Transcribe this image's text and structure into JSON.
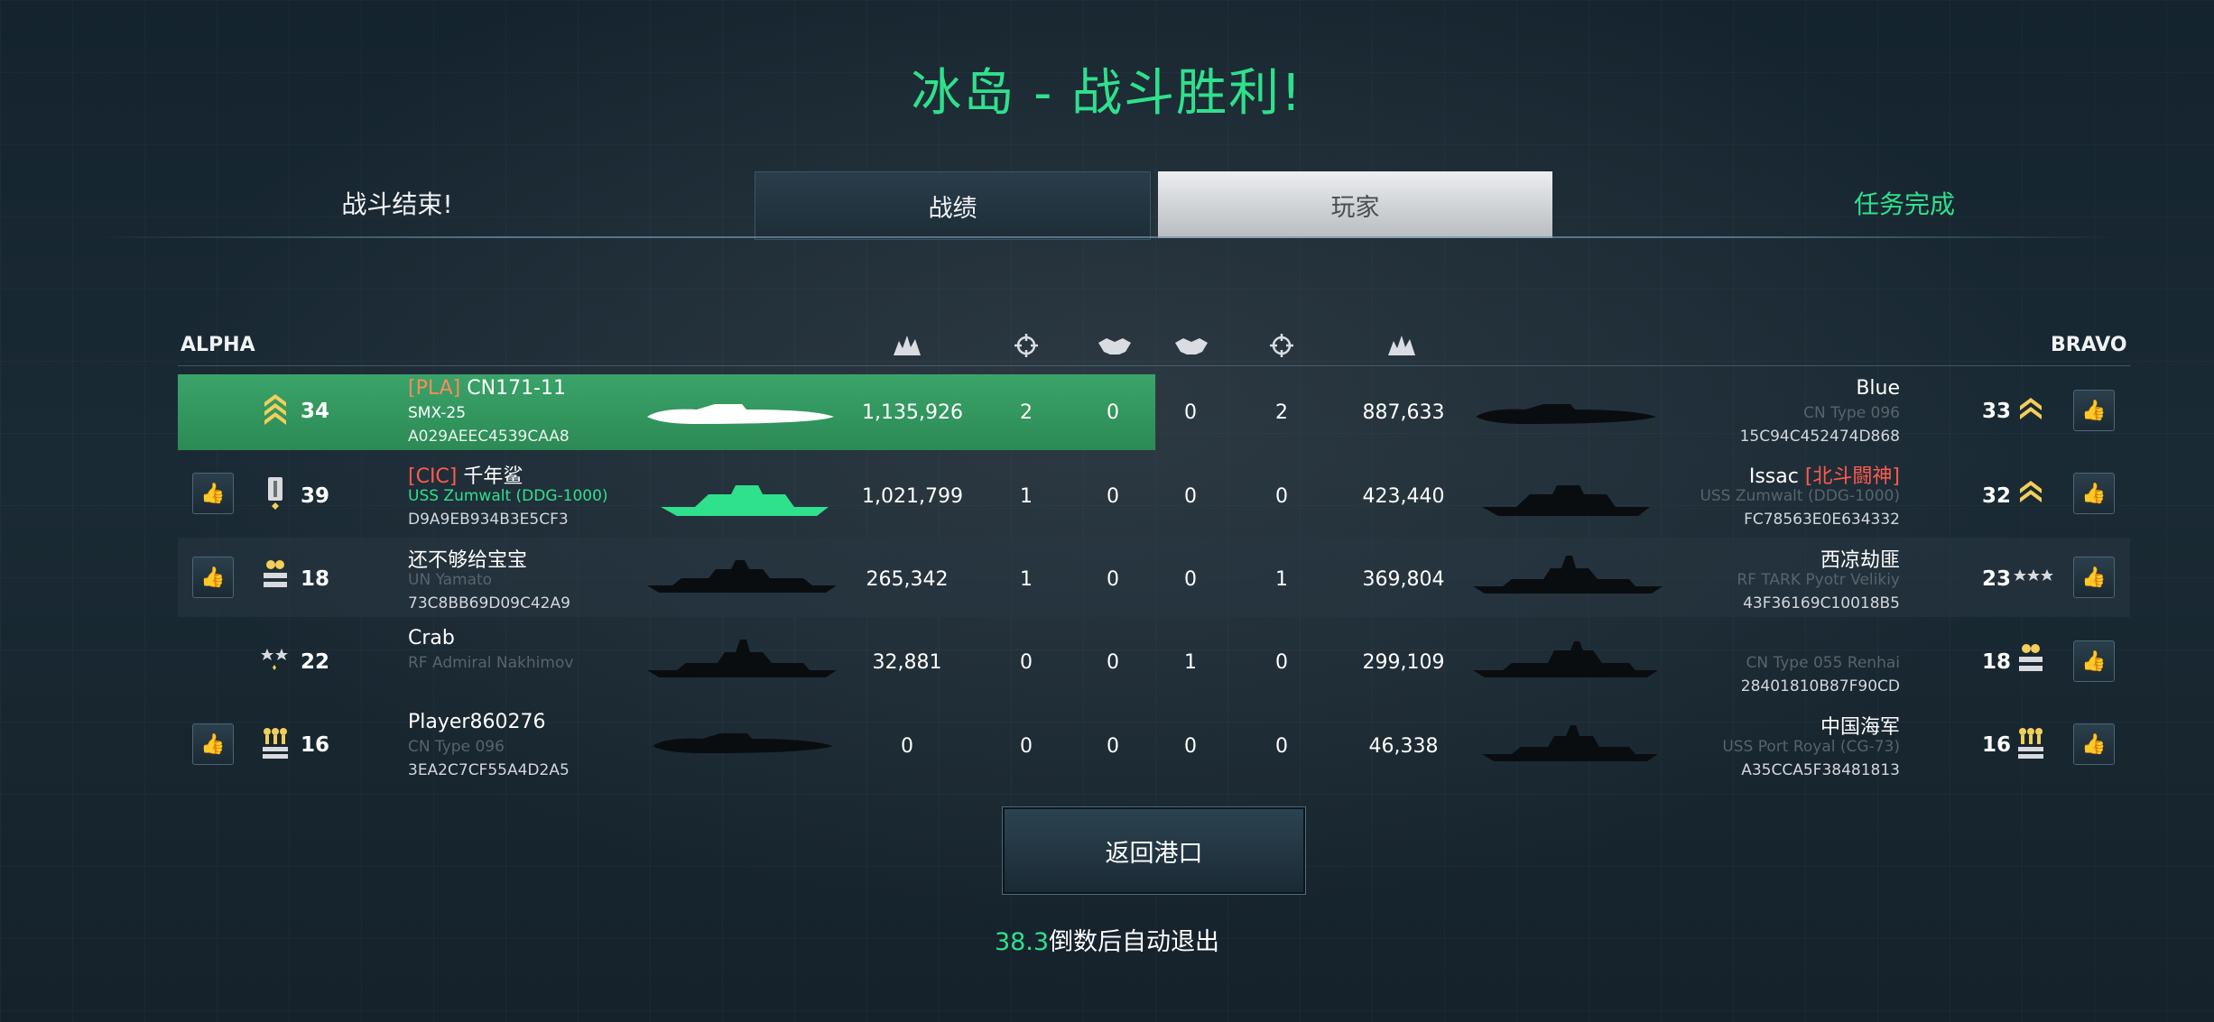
{
  "title": "冰岛 - 战斗胜利!",
  "tabs": {
    "battle_over": "战斗结束!",
    "stats": "战绩",
    "players": "玩家",
    "mission": "任务完成"
  },
  "teams": {
    "alpha": "ALPHA",
    "bravo": "BRAVO"
  },
  "columns": {
    "alpha_damage_icon": "explosion-icon",
    "alpha_kills_icon": "crosshair-icon",
    "alpha_assists_icon": "handshake-icon",
    "bravo_assists_icon": "handshake-icon",
    "bravo_kills_icon": "crosshair-icon",
    "bravo_damage_icon": "explosion-icon"
  },
  "rows": [
    {
      "alpha": {
        "clan": "[PLA]",
        "name": "CN171-11",
        "ship": "SMX-25",
        "code": "A029AEEC4539CAA8",
        "level": "34",
        "rank_icon": "rank-chevron-icon",
        "damage": "1,135,926",
        "kills": "2",
        "assists": "0",
        "highlighted": true,
        "like": false
      },
      "bravo": {
        "name": "Blue",
        "clan": "",
        "ship": "CN Type 096",
        "code": "15C94C452474D868",
        "level": "33",
        "rank_icon": "rank-chevron-icon",
        "damage": "887,633",
        "kills": "2",
        "assists": "0",
        "like": true
      }
    },
    {
      "alpha": {
        "clan": "[CIC]",
        "name": "千年鲨",
        "ship": "USS Zumwalt (DDG-1000)",
        "code": "D9A9EB934B3E5CF3",
        "level": "39",
        "rank_icon": "rank-bar-icon",
        "damage": "1,021,799",
        "kills": "1",
        "assists": "0",
        "like": true,
        "like_active": true
      },
      "bravo": {
        "name": "Issac",
        "clan": "[北斗闘神]",
        "ship": "USS Zumwalt (DDG-1000)",
        "code": "FC78563E0E634332",
        "level": "32",
        "rank_icon": "rank-chevron-icon",
        "damage": "423,440",
        "kills": "0",
        "assists": "0",
        "like": true
      }
    },
    {
      "alpha": {
        "clan": "",
        "name": "还不够给宝宝",
        "ship": "UN Yamato",
        "code": "73C8BB69D09C42A9",
        "level": "18",
        "rank_icon": "rank-stars-icon",
        "damage": "265,342",
        "kills": "1",
        "assists": "0",
        "like": true
      },
      "bravo": {
        "name": "西凉劫匪",
        "clan": "",
        "ship": "RF TARK Pyotr Velikiy",
        "code": "43F36169C10018B5",
        "level": "23",
        "rank_icon": "rank-three-stars-icon",
        "damage": "369,804",
        "kills": "1",
        "assists": "0",
        "like": true
      }
    },
    {
      "alpha": {
        "clan": "",
        "name": "Crab",
        "ship": "RF Admiral Nakhimov",
        "code": "",
        "level": "22",
        "rank_icon": "rank-two-stars-icon",
        "damage": "32,881",
        "kills": "0",
        "assists": "0",
        "like": false
      },
      "bravo": {
        "name": "",
        "clan": "",
        "ship": "CN Type 055 Renhai",
        "code": "28401810B87F90CD",
        "level": "18",
        "rank_icon": "rank-stars-icon",
        "damage": "299,109",
        "kills": "0",
        "assists": "1",
        "like": true
      }
    },
    {
      "alpha": {
        "clan": "",
        "name": "Player860276",
        "ship": "CN Type 096",
        "code": "3EA2C7CF55A4D2A5",
        "level": "16",
        "rank_icon": "rank-medals-icon",
        "damage": "0",
        "kills": "0",
        "assists": "0",
        "like": true
      },
      "bravo": {
        "name": "中国海军",
        "clan": "",
        "ship": "USS Port Royal (CG-73)",
        "code": "A35CCA5F38481813",
        "level": "16",
        "rank_icon": "rank-medals-icon",
        "damage": "46,338",
        "kills": "0",
        "assists": "0",
        "like": true
      }
    }
  ],
  "back_button": "返回港口",
  "countdown": {
    "seconds": "38.3",
    "text": "倒数后自动退出"
  },
  "colors": {
    "accent": "#2fe08c",
    "highlight_row": "#2f8f5a",
    "clan_red": "#ff5a4e"
  }
}
